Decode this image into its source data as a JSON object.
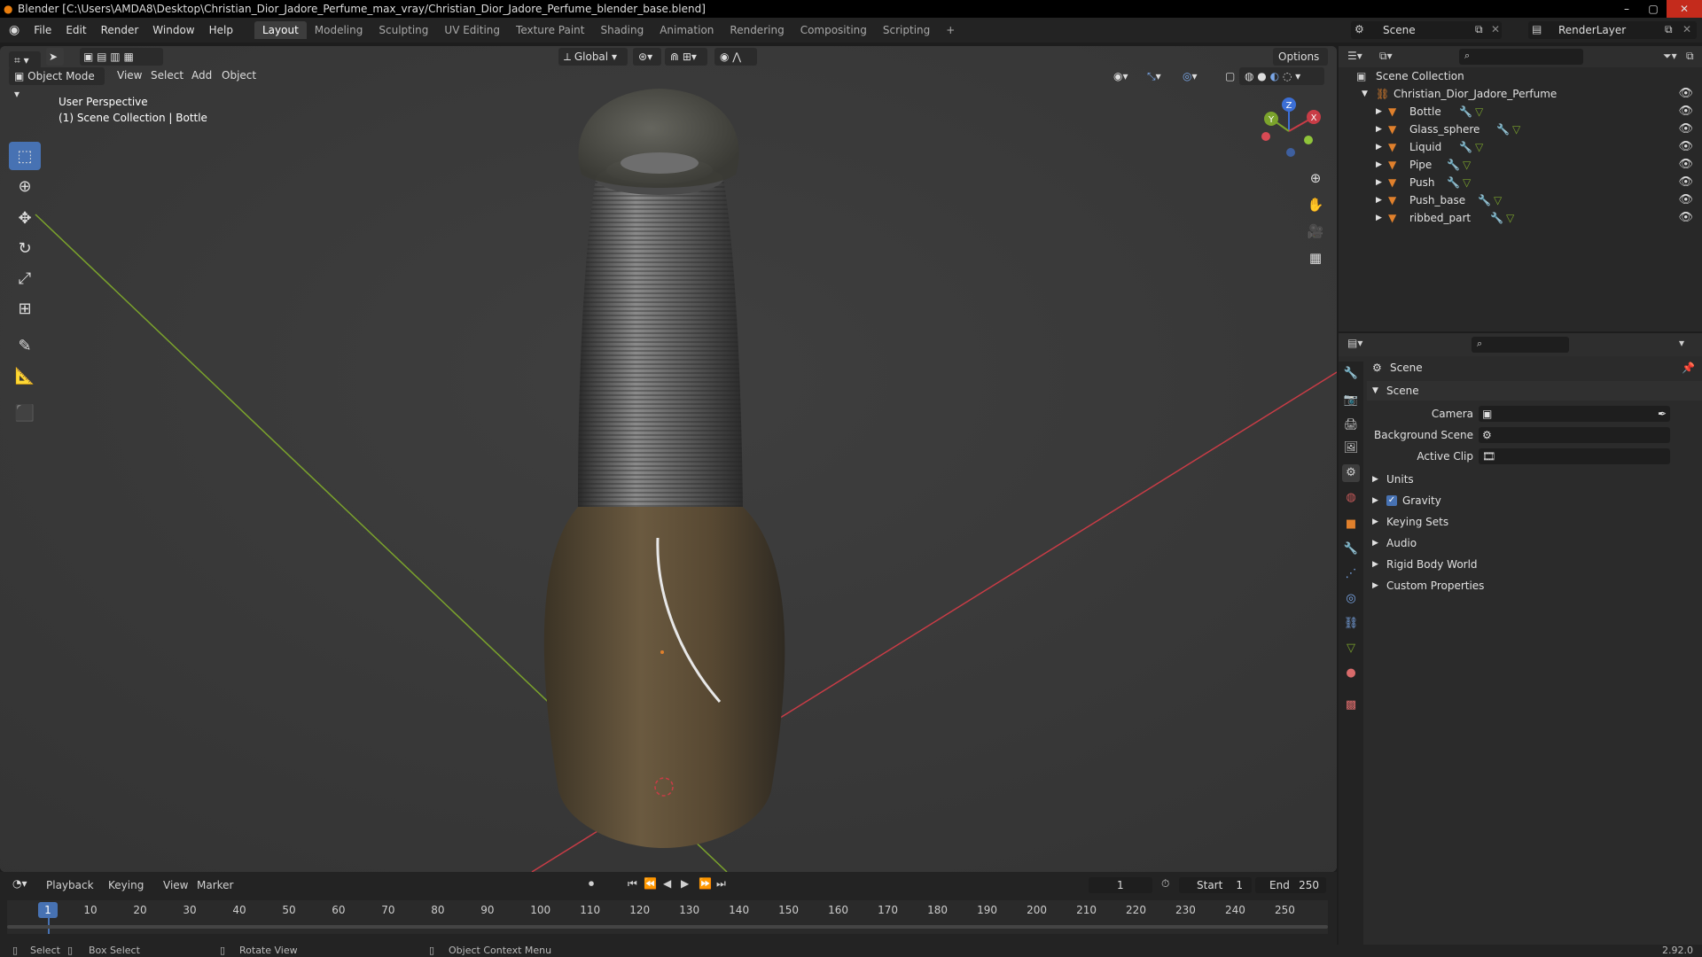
{
  "title_bar": {
    "text": "Blender [C:\\Users\\AMDA8\\Desktop\\Christian_Dior_Jadore_Perfume_max_vray/Christian_Dior_Jadore_Perfume_blender_base.blend]"
  },
  "menu": [
    "File",
    "Edit",
    "Render",
    "Window",
    "Help"
  ],
  "workspaces": [
    "Layout",
    "Modeling",
    "Sculpting",
    "UV Editing",
    "Texture Paint",
    "Shading",
    "Animation",
    "Rendering",
    "Compositing",
    "Scripting"
  ],
  "active_workspace": "Layout",
  "scene_name": "Scene",
  "render_layer": "RenderLayer",
  "viewport": {
    "mode": "Object Mode",
    "menus": [
      "View",
      "Select",
      "Add",
      "Object"
    ],
    "orientation": "Global",
    "options_label": "Options",
    "perspective_label": "User Perspective",
    "collection_label": "(1) Scene Collection | Bottle",
    "gizmo_axes": {
      "x": "X",
      "y": "Y",
      "z": "Z"
    }
  },
  "outliner": {
    "root": "Scene Collection",
    "collection": "Christian_Dior_Jadore_Perfume",
    "objects": [
      "Bottle",
      "Glass_sphere",
      "Liquid",
      "Pipe",
      "Push",
      "Push_base",
      "ribbed_part"
    ]
  },
  "properties": {
    "header": "Scene",
    "panel_title": "Scene",
    "fields": {
      "camera": "Camera",
      "background_scene": "Background Scene",
      "active_clip": "Active Clip"
    },
    "sections": [
      "Units",
      "Gravity",
      "Keying Sets",
      "Audio",
      "Rigid Body World",
      "Custom Properties"
    ],
    "gravity_checked": true
  },
  "timeline": {
    "menus": [
      "Playback",
      "Keying",
      "View",
      "Marker"
    ],
    "current_frame": "1",
    "start_label": "Start",
    "start": "1",
    "end_label": "End",
    "end": "250",
    "ticks": [
      "1",
      "10",
      "20",
      "30",
      "40",
      "50",
      "60",
      "70",
      "80",
      "90",
      "100",
      "110",
      "120",
      "130",
      "140",
      "150",
      "160",
      "170",
      "180",
      "190",
      "200",
      "210",
      "220",
      "230",
      "240",
      "250"
    ]
  },
  "status_bar": {
    "select": "Select",
    "box_select": "Box Select",
    "rotate_view": "Rotate View",
    "context_menu": "Object Context Menu",
    "version": "2.92.0"
  },
  "colors": {
    "accent": "#4772b3",
    "x_axis": "#c83c46",
    "y_axis": "#7ba32c",
    "z_axis": "#3c6fd6",
    "orange": "#e0802c"
  }
}
